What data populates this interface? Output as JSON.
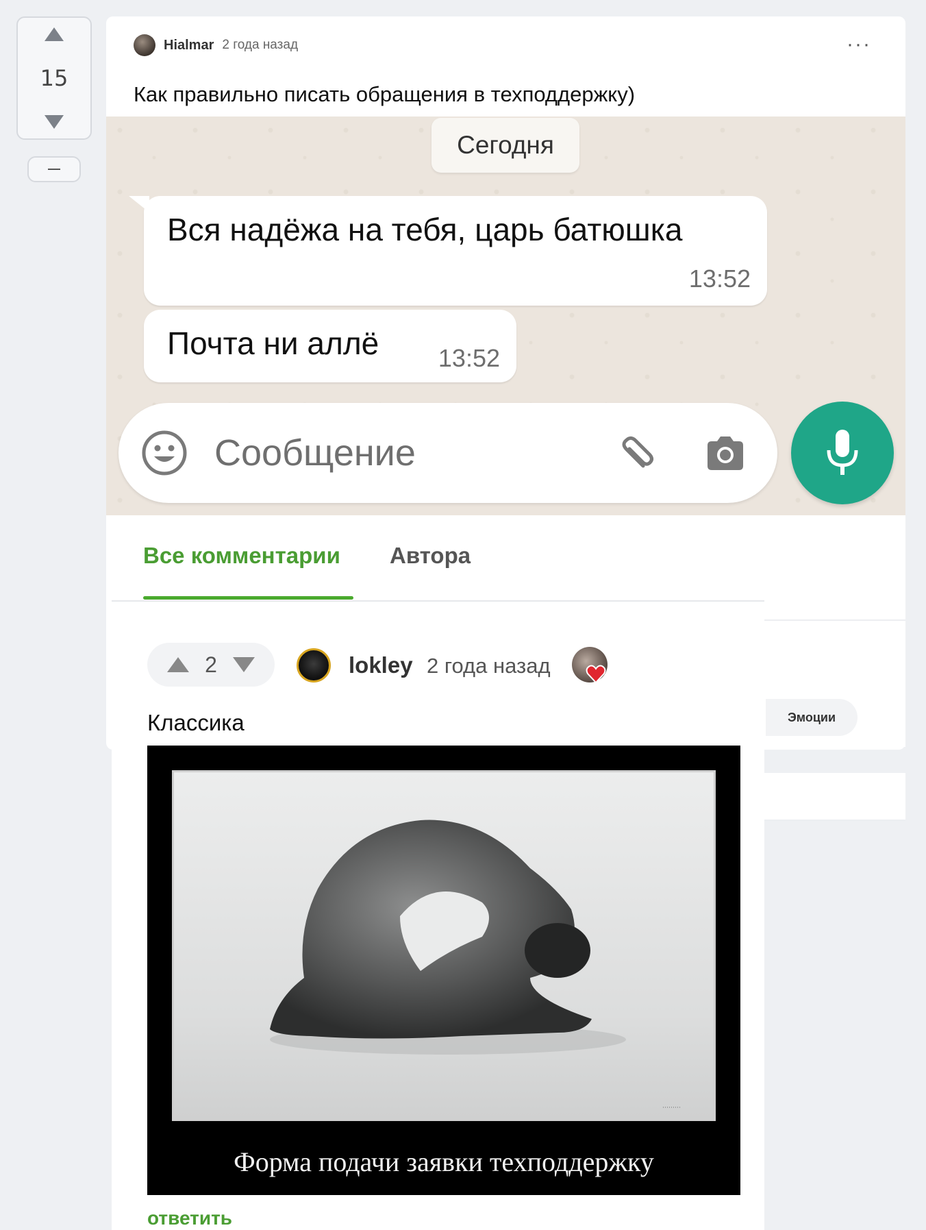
{
  "post": {
    "votes": "15",
    "author": "Hialmar",
    "time": "2 года назад",
    "title": "Как правильно писать обращения в техподдержку)",
    "more_icon": "more-dots-icon"
  },
  "chat": {
    "date_label": "Сегодня",
    "messages": [
      {
        "text": "Вся надёжа на тебя, царь батюшка",
        "time": "13:52"
      },
      {
        "text": "Почта ни аллё",
        "time": "13:52"
      }
    ],
    "input_placeholder": "Сообщение",
    "icons": [
      "emoji-icon",
      "attach-icon",
      "camera-icon",
      "mic-icon"
    ],
    "accent": "#1fa688"
  },
  "tabs": {
    "all": "Все комментарии",
    "author": "Автора",
    "active_color": "#4a9d33"
  },
  "comment": {
    "votes": "2",
    "author": "lokley",
    "time": "2 года назад",
    "text": "Классика",
    "image_caption": "Форма подачи заявки техподдержку",
    "reply": "ответить",
    "emotions": "Эмоции"
  }
}
